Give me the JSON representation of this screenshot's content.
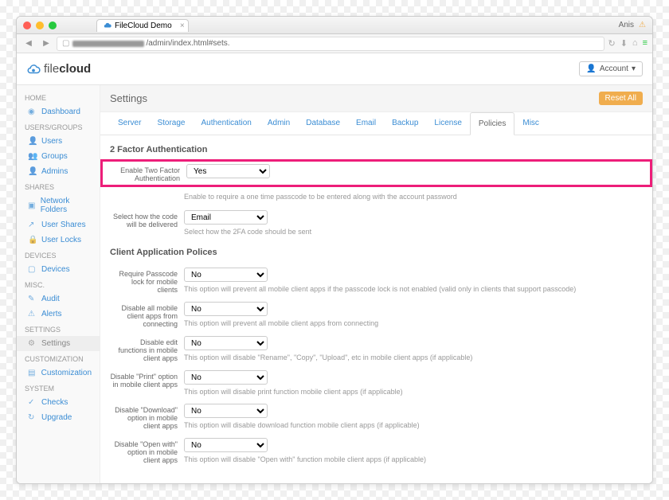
{
  "browser": {
    "tab_title": "FileCloud Demo",
    "user_label": "Anis",
    "url_suffix": "/admin/index.html#sets."
  },
  "topbar": {
    "logo_light": "file",
    "logo_bold": "cloud",
    "account_label": "Account"
  },
  "sidebar": {
    "sections": [
      {
        "header": "HOME",
        "items": [
          {
            "id": "dashboard",
            "label": "Dashboard",
            "icon": "◉"
          }
        ]
      },
      {
        "header": "USERS/GROUPS",
        "items": [
          {
            "id": "users",
            "label": "Users",
            "icon": "👤"
          },
          {
            "id": "groups",
            "label": "Groups",
            "icon": "👥"
          },
          {
            "id": "admins",
            "label": "Admins",
            "icon": "👤"
          }
        ]
      },
      {
        "header": "SHARES",
        "items": [
          {
            "id": "network-folders",
            "label": "Network Folders",
            "icon": "▣"
          },
          {
            "id": "user-shares",
            "label": "User Shares",
            "icon": "↗"
          },
          {
            "id": "user-locks",
            "label": "User Locks",
            "icon": "🔒"
          }
        ]
      },
      {
        "header": "DEVICES",
        "items": [
          {
            "id": "devices",
            "label": "Devices",
            "icon": "▢"
          }
        ]
      },
      {
        "header": "MISC.",
        "items": [
          {
            "id": "audit",
            "label": "Audit",
            "icon": "✎"
          },
          {
            "id": "alerts",
            "label": "Alerts",
            "icon": "⚠"
          }
        ]
      },
      {
        "header": "SETTINGS",
        "items": [
          {
            "id": "settings",
            "label": "Settings",
            "icon": "⚙",
            "active": true
          }
        ]
      },
      {
        "header": "CUSTOMIZATION",
        "items": [
          {
            "id": "customization",
            "label": "Customization",
            "icon": "▤"
          }
        ]
      },
      {
        "header": "SYSTEM",
        "items": [
          {
            "id": "checks",
            "label": "Checks",
            "icon": "✓"
          },
          {
            "id": "upgrade",
            "label": "Upgrade",
            "icon": "↻"
          }
        ]
      }
    ]
  },
  "page": {
    "title": "Settings",
    "reset_label": "Reset All"
  },
  "tabs": [
    {
      "id": "server",
      "label": "Server"
    },
    {
      "id": "storage",
      "label": "Storage"
    },
    {
      "id": "authentication",
      "label": "Authentication"
    },
    {
      "id": "admin",
      "label": "Admin"
    },
    {
      "id": "database",
      "label": "Database"
    },
    {
      "id": "email",
      "label": "Email"
    },
    {
      "id": "backup",
      "label": "Backup"
    },
    {
      "id": "license",
      "label": "License"
    },
    {
      "id": "policies",
      "label": "Policies",
      "active": true
    },
    {
      "id": "misc",
      "label": "Misc"
    }
  ],
  "sections": {
    "two_factor": {
      "title": "2 Factor Authentication",
      "enable_label": "Enable Two Factor Authentication",
      "enable_value": "Yes",
      "enable_help": "Enable to require a one time passcode to be entered along with the account password",
      "delivery_label": "Select how the code will be delivered",
      "delivery_value": "Email",
      "delivery_help": "Select how the 2FA code should be sent"
    },
    "client_policies": {
      "title": "Client Application Polices",
      "rows": [
        {
          "id": "passcode",
          "label": "Require Passcode lock for mobile clients",
          "value": "No",
          "help": "This option will prevent all mobile client apps if the passcode lock is not enabled (valid only in clients that support passcode)"
        },
        {
          "id": "disable-mobile",
          "label": "Disable all mobile client apps from connecting",
          "value": "No",
          "help": "This option will prevent all mobile client apps from connecting"
        },
        {
          "id": "disable-edit",
          "label": "Disable edit functions in mobile client apps",
          "value": "No",
          "help": "This option will disable \"Rename\", \"Copy\", \"Upload\", etc in mobile client apps (if applicable)"
        },
        {
          "id": "disable-print",
          "label": "Disable \"Print\" option in mobile client apps",
          "value": "No",
          "help": "This option will disable print function mobile client apps (if applicable)"
        },
        {
          "id": "disable-download",
          "label": "Disable \"Download\" option in mobile client apps",
          "value": "No",
          "help": "This option will disable download function mobile client apps (if applicable)"
        },
        {
          "id": "disable-openwith",
          "label": "Disable \"Open with\" option in mobile client apps",
          "value": "No",
          "help": "This option will disable \"Open with\" function mobile client apps (if applicable)"
        }
      ]
    }
  }
}
